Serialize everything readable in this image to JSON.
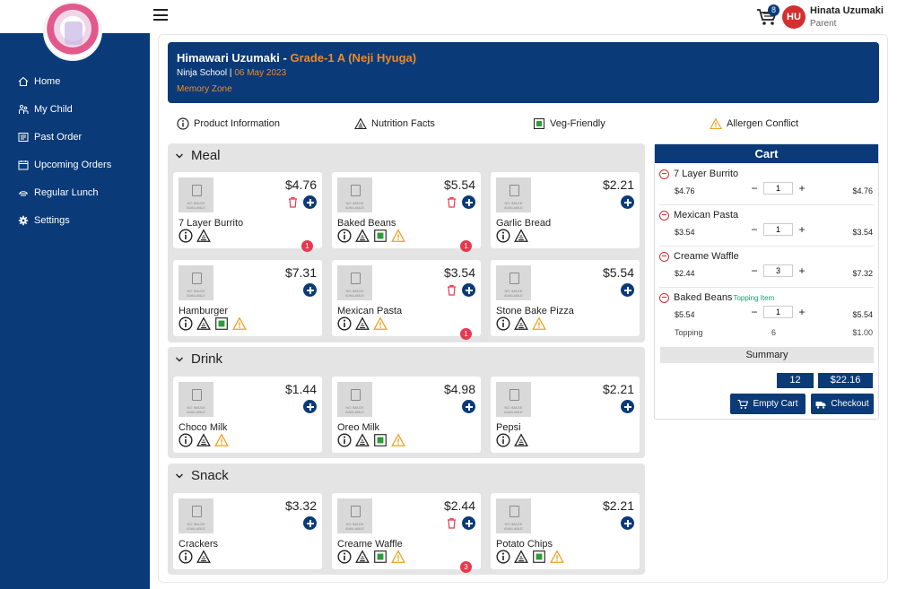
{
  "header": {
    "cart_count": "8",
    "avatar_initials": "HU",
    "user_name": "Hinata Uzumaki",
    "user_role": "Parent"
  },
  "sidebar": {
    "items": [
      {
        "label": "Home",
        "icon": "home-icon"
      },
      {
        "label": "My Child",
        "icon": "child-icon"
      },
      {
        "label": "Past Order",
        "icon": "past-order-icon"
      },
      {
        "label": "Upcoming Orders",
        "icon": "calendar-icon"
      },
      {
        "label": "Regular Lunch",
        "icon": "lunch-icon"
      },
      {
        "label": "Settings",
        "icon": "gear-icon"
      }
    ]
  },
  "student": {
    "name": "Himawari Uzumaki -",
    "grade": "Grade-1 A (Neji Hyuga)",
    "school": "Ninja School |",
    "date": "06 May 2023",
    "zone": "Memory Zone"
  },
  "legend": {
    "product_info": "Product Information",
    "nutrition": "Nutrition Facts",
    "veg": "Veg-Friendly",
    "allergen": "Allergen Conflict"
  },
  "no_image_text": "NO IMAGE AVAILABLE",
  "categories": [
    {
      "name": "Meal",
      "items": [
        {
          "name": "7 Layer Burrito",
          "price": "$4.76",
          "qty": "1"
        },
        {
          "name": "Baked Beans",
          "price": "$5.54",
          "qty": "1"
        },
        {
          "name": "Garlic Bread",
          "price": "$2.21"
        },
        {
          "name": "Hamburger",
          "price": "$7.31"
        },
        {
          "name": "Mexican Pasta",
          "price": "$3.54",
          "qty": "1"
        },
        {
          "name": "Stone Bake Pizza",
          "price": "$5.54"
        }
      ]
    },
    {
      "name": "Drink",
      "items": [
        {
          "name": "Choco Milk",
          "price": "$1.44"
        },
        {
          "name": "Oreo Milk",
          "price": "$4.98"
        },
        {
          "name": "Pepsi",
          "price": "$2.21"
        }
      ]
    },
    {
      "name": "Snack",
      "items": [
        {
          "name": "Crackers",
          "price": "$3.32"
        },
        {
          "name": "Creame Waffle",
          "price": "$2.44",
          "qty": "3"
        },
        {
          "name": "Potato Chips",
          "price": "$2.21"
        }
      ]
    }
  ],
  "cart": {
    "title": "Cart",
    "items": [
      {
        "name": "7 Layer Burrito",
        "price": "$4.76",
        "qty": "1",
        "total": "$4.76"
      },
      {
        "name": "Mexican Pasta",
        "price": "$3.54",
        "qty": "1",
        "total": "$3.54"
      },
      {
        "name": "Creame Waffle",
        "price": "$2.44",
        "qty": "3",
        "total": "$7.32"
      },
      {
        "name": "Baked Beans",
        "tag": "Topping Item",
        "price": "$5.54",
        "qty": "1",
        "total": "$5.54"
      }
    ],
    "topping": {
      "label": "Topping",
      "count": "6",
      "amount": "$1.00"
    },
    "summary_label": "Summary",
    "summary_count": "12",
    "summary_total": "$22.16",
    "empty_label": "Empty Cart",
    "checkout_label": "Checkout"
  },
  "colors": {
    "brand": "#0a3a78",
    "accent": "#f08a24",
    "danger": "#d32f2f",
    "veg": "#2e9b3a"
  }
}
